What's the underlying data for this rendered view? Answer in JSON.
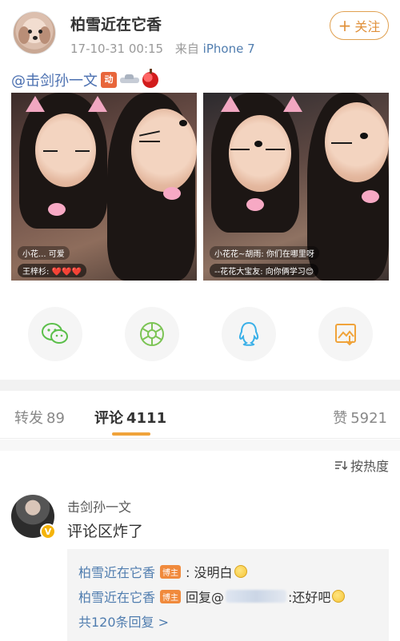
{
  "post": {
    "author": "柏雪近在它香",
    "time": "17-10-31 00:15",
    "source_prefix": "来自",
    "device": "iPhone 7",
    "follow_label": "关注",
    "text_mention": "@击剑孙一文",
    "emoji_badge_text": "动",
    "photos": [
      {
        "chat_lines": [
          "小花...  可爱",
          "王梓杉: ❤️❤️❤️"
        ]
      },
      {
        "chat_lines": [
          "小花花~胡雨: 你们在哪里呀",
          "--花花大宝友: 向你俩学习😊"
        ]
      }
    ]
  },
  "share": {
    "icons": [
      "wechat-icon",
      "moments-icon",
      "qq-icon",
      "save-image-icon"
    ]
  },
  "tabs": {
    "repost_label": "转发",
    "repost_count": "89",
    "comment_label": "评论",
    "comment_count": "4111",
    "like_label": "赞",
    "like_count": "5921"
  },
  "sort": {
    "label": "按热度"
  },
  "comment": {
    "author": "击剑孙一文",
    "text": "评论区炸了",
    "verified_badge": "V",
    "replies": [
      {
        "user": "柏雪近在它香",
        "badge": "博主",
        "text": ": 没明白"
      },
      {
        "user": "柏雪近在它香",
        "badge": "博主",
        "prefix": "回复@",
        "text": ":还好吧"
      }
    ],
    "more_replies": "共120条回复 >"
  },
  "colors": {
    "link": "#507daf",
    "accent": "#f0a33a",
    "host_badge": "#f08a3c"
  }
}
